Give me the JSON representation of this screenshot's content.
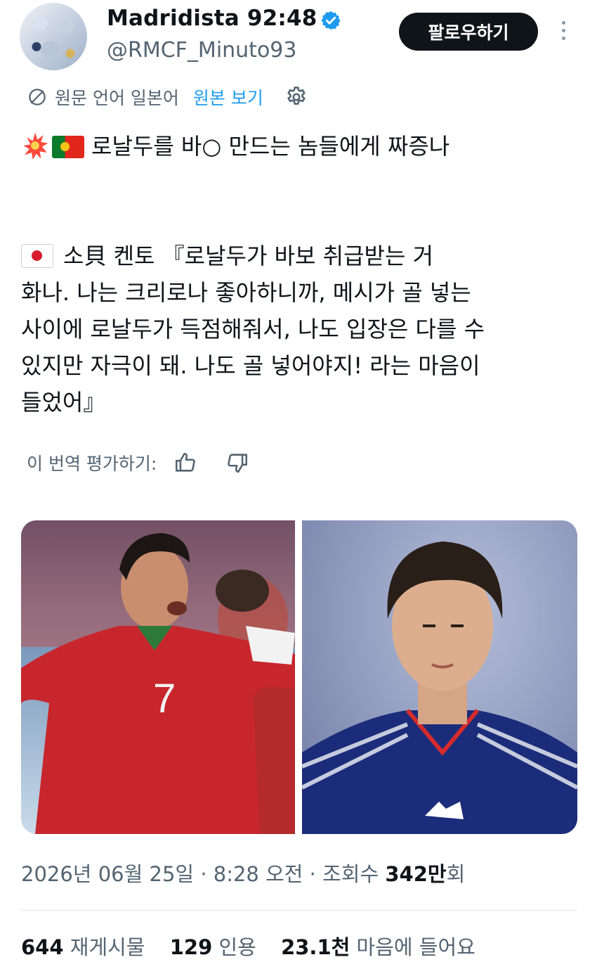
{
  "header": {
    "display_name": "Madridista 92:48",
    "handle": "@RMCF_Minuto93",
    "follow_label": "팔로우하기"
  },
  "translation": {
    "source_language": "원문 언어 일본어",
    "show_original": "원본 보기",
    "rate_label": "이 번역 평가하기:"
  },
  "tweet": {
    "line1": "로날두를 바○ 만드는 놈들에게 짜증나",
    "line2_prefix": "소貝 켄토",
    "line2_rest": "『로날두가 바보 취급받는 거\n화나. 나는 크리로나 좋아하니까, 메시가 골 넣는\n사이에 로날두가 득점해줘서, 나도 입장은 다를 수\n있지만 자극이 돼. 나도 골 넣어야지! 라는 마음이\n들었어』"
  },
  "media": {
    "jersey_number": "7"
  },
  "meta": {
    "date": "2026년 06월 25일",
    "time": "8:28 오전",
    "views_label": "조회수",
    "views_value": "342만",
    "views_suffix": "회"
  },
  "stats": {
    "reposts_count": "644",
    "reposts_label": "재게시물",
    "quotes_count": "129",
    "quotes_label": "인용",
    "likes_count": "23.1천",
    "likes_label": "마음에 들어요"
  },
  "colors": {
    "accent": "#1d9bf0",
    "text_primary": "#0f1419",
    "text_secondary": "#536471"
  }
}
